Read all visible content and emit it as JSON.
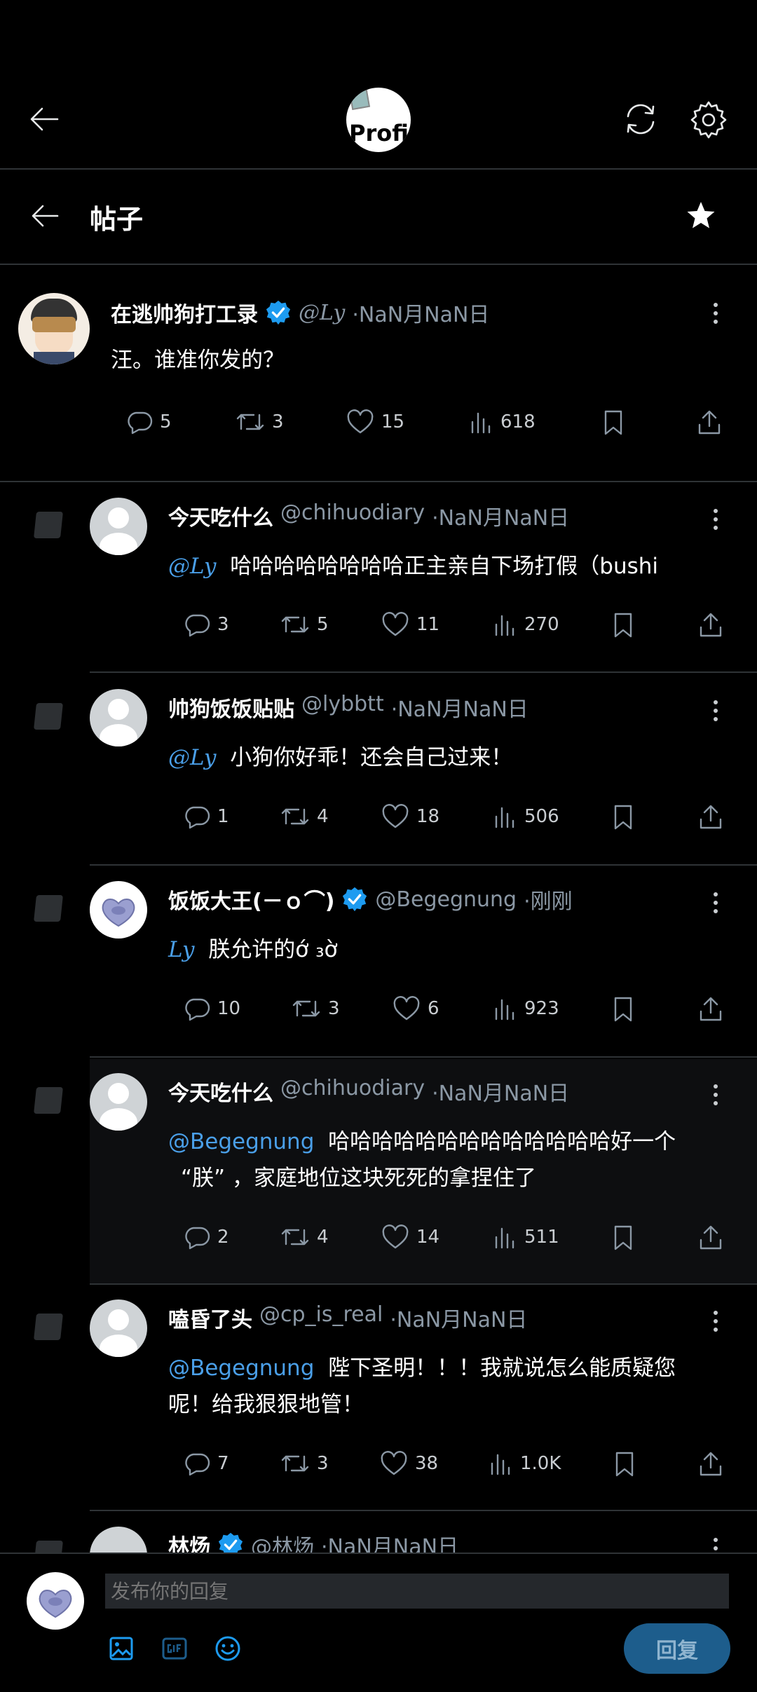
{
  "top_bar": {
    "profile_alt": "Profi"
  },
  "header": {
    "title": "帖子"
  },
  "main_post": {
    "author": "在逃帅狗打工录",
    "handle": "@Ly",
    "date": "·NaN月NaN日",
    "text": "汪。谁准你发的？",
    "stats": {
      "replies": "5",
      "reposts": "3",
      "likes": "15",
      "views": "618"
    }
  },
  "replies": [
    {
      "author": "今天吃什么",
      "handle": "@chihuodiary",
      "date": "·NaN月NaN日",
      "mention": "@Ly",
      "text": "哈哈哈哈哈哈哈哈正主亲自下场打假（bushi",
      "stats": {
        "replies": "3",
        "reposts": "5",
        "likes": "11",
        "views": "270"
      }
    },
    {
      "author": "帅狗饭饭贴贴",
      "handle": "@lybbtt",
      "date": "·NaN月NaN日",
      "mention": "@Ly",
      "text": "小狗你好乖！还会自己过来！",
      "stats": {
        "replies": "1",
        "reposts": "4",
        "likes": "18",
        "views": "506"
      }
    },
    {
      "author": "饭饭大王(－ｏ⌒)",
      "handle": "@Begegnung",
      "date": "·刚刚",
      "mention": "Ly",
      "text": "朕允许的ớ ₃ờ",
      "stats": {
        "replies": "10",
        "reposts": "3",
        "likes": "6",
        "views": "923"
      }
    },
    {
      "author": "今天吃什么",
      "handle": "@chihuodiary",
      "date": "·NaN月NaN日",
      "mention": "@Begegnung",
      "text": "哈哈哈哈哈哈哈哈哈哈哈哈哈好一个",
      "text2": "“朕” ，家庭地位这块死死的拿捏住了",
      "stats": {
        "replies": "2",
        "reposts": "4",
        "likes": "14",
        "views": "511"
      }
    },
    {
      "author": "嗑昏了头",
      "handle": "@cp_is_real",
      "date": "·NaN月NaN日",
      "mention": "@Begegnung",
      "text": "陛下圣明！！！我就说怎么能质疑您",
      "text2": "呢！给我狠狠地管！",
      "stats": {
        "replies": "7",
        "reposts": "3",
        "likes": "38",
        "views": "1.0K"
      }
    },
    {
      "author": "林炀",
      "handle": "@林炀",
      "date": "·NaN月NaN日"
    }
  ],
  "composer": {
    "placeholder": "发布你的回复",
    "reply_label": "回复"
  },
  "colors": {
    "accent": "#4a9fe8",
    "verified": "#1d9bf0",
    "background": "#000000"
  }
}
